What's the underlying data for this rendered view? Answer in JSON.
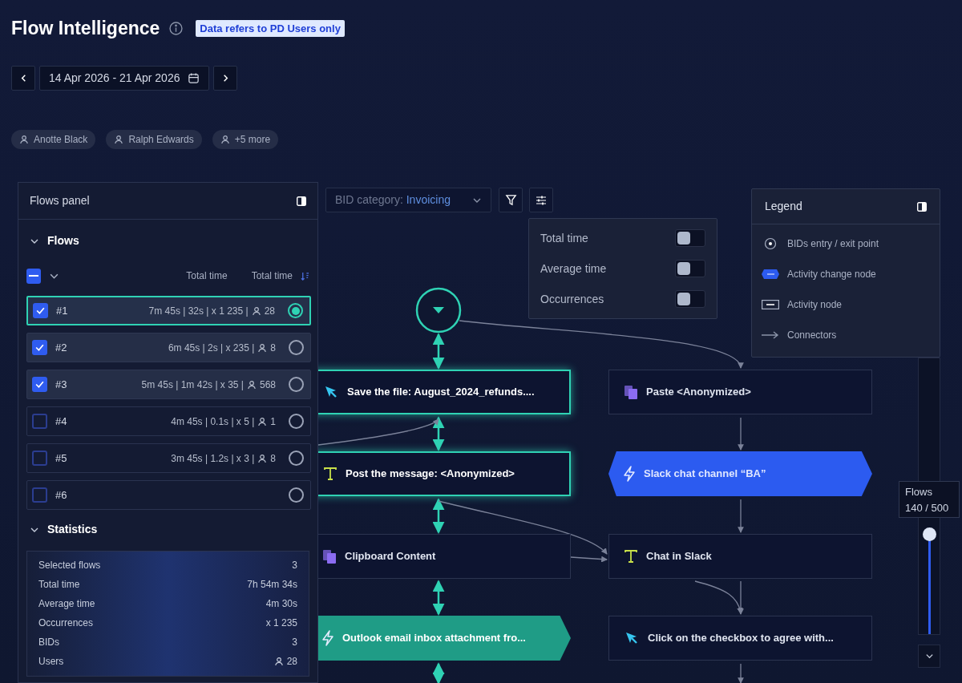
{
  "header": {
    "title": "Flow Intelligence",
    "badge": "Data refers to PD Users only"
  },
  "date_range": {
    "value": "14 Apr 2026 - 21 Apr 2026"
  },
  "user_chips": [
    "Anotte Black",
    "Ralph Edwards",
    "+5 more"
  ],
  "flows_panel": {
    "title": "Flows panel",
    "flows_section": {
      "title": "Flows",
      "expanded": true,
      "select_all_indeterminate": true,
      "columns": [
        "Total time",
        "Total time"
      ],
      "flows": [
        {
          "label": "#1",
          "stats": "7m 45s | 32s | x 1 235 |",
          "users": "28",
          "checked": true,
          "selected": true
        },
        {
          "label": "#2",
          "stats": "6m 45s | 2s | x 235 |",
          "users": "8",
          "checked": true,
          "selected": false
        },
        {
          "label": "#3",
          "stats": "5m 45s | 1m 42s | x 35 |",
          "users": "568",
          "checked": true,
          "selected": false
        },
        {
          "label": "#4",
          "stats": "4m 45s | 0.1s | x 5 |",
          "users": "1",
          "checked": false,
          "selected": false
        },
        {
          "label": "#5",
          "stats": "3m 45s | 1.2s | x 3 |",
          "users": "8",
          "checked": false,
          "selected": false
        },
        {
          "label": "#6",
          "checked": false,
          "selected": false
        }
      ]
    },
    "statistics": {
      "title": "Statistics",
      "expanded": true,
      "rows": [
        {
          "label": "Selected flows",
          "value": "3",
          "kind": "plain"
        },
        {
          "label": "Total time",
          "value": "7h 54m 34s",
          "kind": "plain"
        },
        {
          "label": "Average time",
          "value": "4m 30s",
          "kind": "plain"
        },
        {
          "label": "Occurrences",
          "value": "x 1 235",
          "kind": "plain"
        },
        {
          "label": "BIDs",
          "value": "3",
          "kind": "plain"
        },
        {
          "label": "Users",
          "value": "28",
          "kind": "users"
        }
      ]
    }
  },
  "canvas": {
    "category_label": "BID category:",
    "category_value": "Invoicing",
    "metrics": [
      {
        "label": "Total time",
        "on": false
      },
      {
        "label": "Average time",
        "on": false
      },
      {
        "label": "Occurrences",
        "on": false
      }
    ],
    "columns": [
      {
        "nodes": [
          {
            "label": "Save the file: August_2024_refunds....",
            "kind": "activity",
            "highlighted": true
          },
          {
            "label": "Post the message: <Anonymized>",
            "kind": "activity",
            "highlighted": true
          },
          {
            "label": "Clipboard Content",
            "kind": "activity",
            "highlighted": false
          },
          {
            "label": "Outlook email inbox attachment fro...",
            "kind": "change",
            "highlighted": true
          }
        ]
      },
      {
        "nodes": [
          {
            "label": "Paste <Anonymized>",
            "kind": "activity",
            "highlighted": false
          },
          {
            "label": "Slack chat channel “BA”",
            "kind": "change",
            "highlighted": false
          },
          {
            "label": "Chat in Slack",
            "kind": "activity",
            "highlighted": false
          },
          {
            "label": "Click on the checkbox to agree with...",
            "kind": "activity",
            "highlighted": false
          }
        ]
      }
    ]
  },
  "legend": {
    "title": "Legend",
    "items": [
      {
        "kind": "entry",
        "label": "BIDs entry / exit point"
      },
      {
        "kind": "change",
        "label": "Activity change node"
      },
      {
        "kind": "activity",
        "label": "Activity node"
      },
      {
        "kind": "connector",
        "label": "Connectors"
      }
    ]
  },
  "flows_slider": {
    "label": "Flows",
    "reading": "140 / 500",
    "level": 0.36
  }
}
